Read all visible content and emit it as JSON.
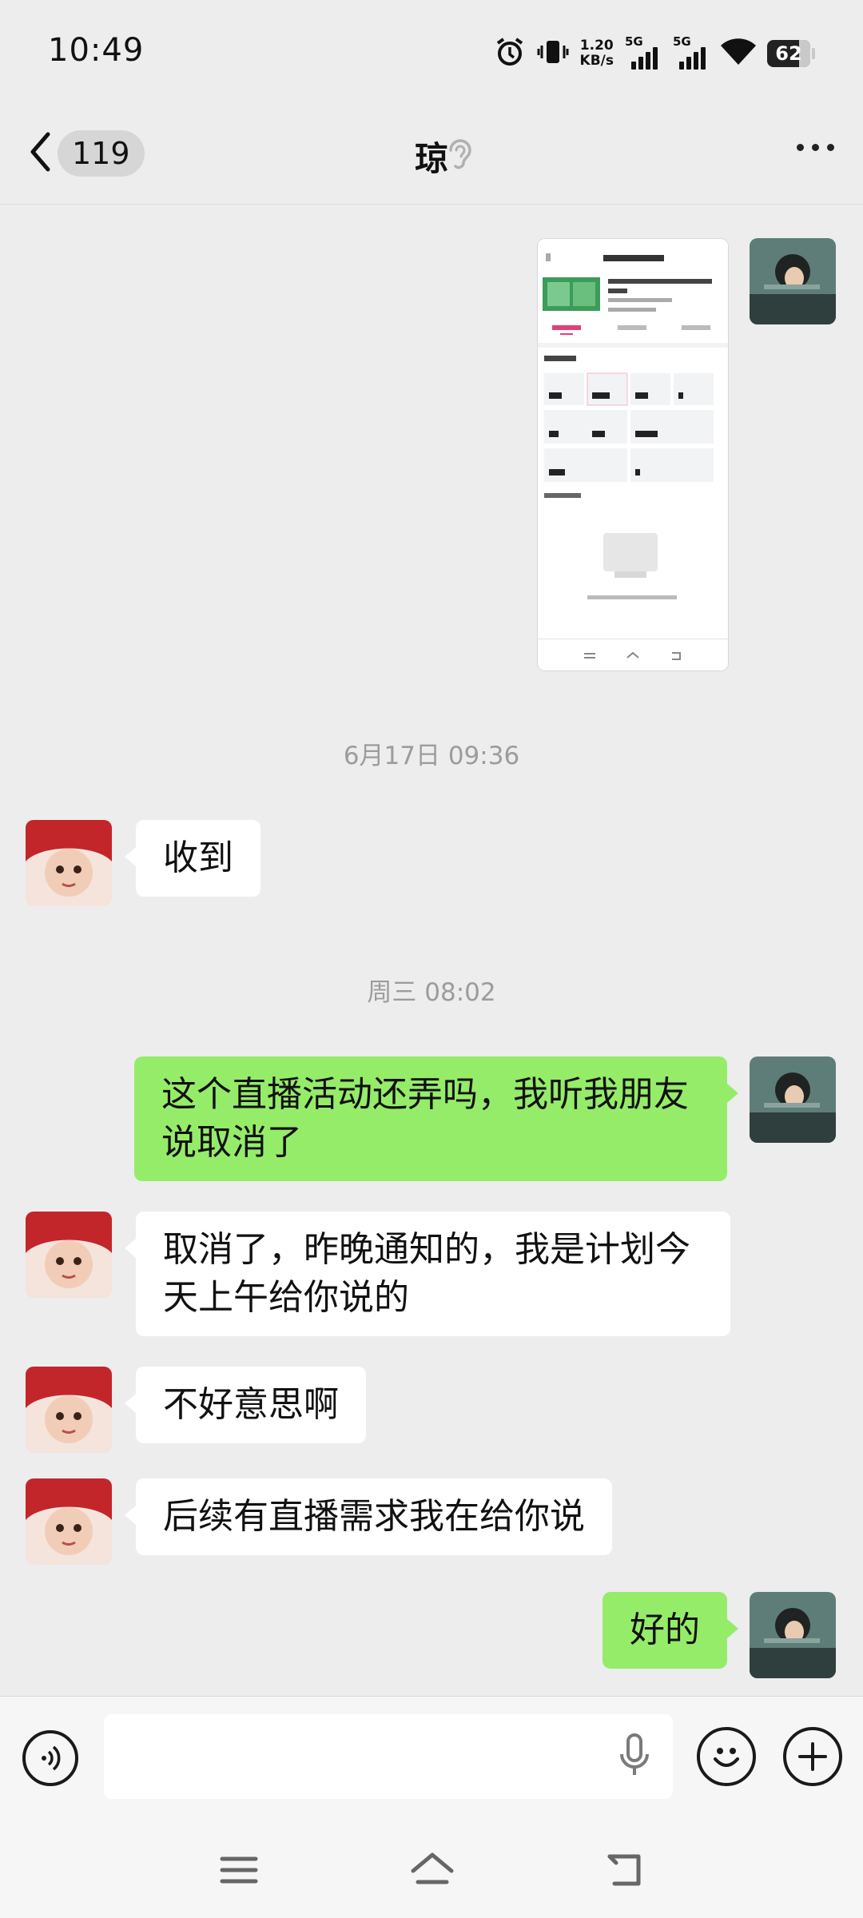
{
  "status_bar": {
    "time": "10:49",
    "net_speed_value": "1.20",
    "net_speed_unit": "KB/s",
    "signal1_label": "5G",
    "signal2_label": "5G",
    "battery": "62",
    "icons": [
      "alarm-icon",
      "vibrate-icon",
      "wifi-icon",
      "battery-icon"
    ]
  },
  "header": {
    "unread_count": "119",
    "title": "琼",
    "icons": [
      "back-icon",
      "ear-icon",
      "more-icon"
    ]
  },
  "messages": {
    "timestamp_1": "6月17日 09:36",
    "msg_received_1": "收到",
    "timestamp_2": "周三 08:02",
    "msg_sent_1": "这个直播活动还弄吗，我听我朋友说取消了",
    "msg_received_2": "取消了，昨晚通知的，我是计划今天上午给你说的",
    "msg_received_3": "不好意思啊",
    "msg_received_4": "后续有直播需求我在给你说",
    "msg_sent_2": "好的"
  },
  "input_bar": {
    "placeholder": "",
    "icons": [
      "voice-icon",
      "mic-icon",
      "emoji-icon",
      "plus-icon"
    ]
  },
  "colors": {
    "background": "#ededed",
    "sent_bubble": "#95ec69",
    "received_bubble": "#ffffff",
    "timestamp": "#9c9c9c"
  }
}
